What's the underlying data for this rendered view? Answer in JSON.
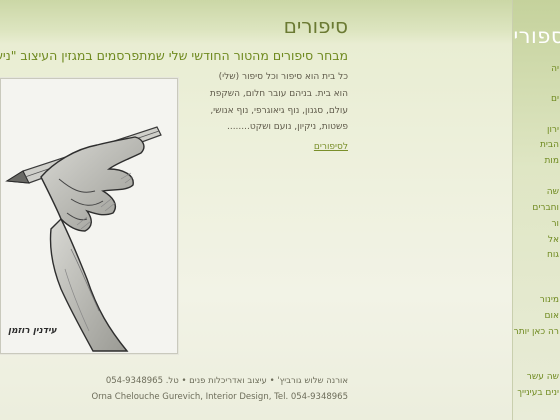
{
  "sidebar": {
    "title": "ספורים",
    "items": [
      "יה",
      "ים",
      "ירון",
      "הבית",
      "מות",
      "שה",
      "וחברים",
      "ור",
      "אל",
      "גוח",
      "מינור",
      "אום",
      "רה כאן יותר",
      "שה עשר",
      "ינים בעינייך"
    ]
  },
  "main": {
    "title": "סיפורים",
    "subheading": "מבחר סיפורים מהטור החודשי שלי שמתפרסמים במגזין העיצוב \"נישה\"",
    "body_lines": [
      "כל בית הוא סיפור וכל סיפור (שלי)",
      "הוא בית. בניהם עובר חלום, השקפת",
      "עולם, סגנון, נוף גיאוגרפי, נוף אנושי,",
      "פשטות, ניקיון, נועם ושקט........"
    ],
    "more_link": "לסיפורים"
  },
  "artwork": {
    "signature": "עידנין רוזמן"
  },
  "footer": {
    "hebrew": "אורנה שלוש גורביץ'  •  עיצוב ואדריכלות פנים  •  טל. 054-9348965",
    "english": "Orna Chelouche Gurevich,   Interior Design,   Tel. 054-9348965"
  }
}
